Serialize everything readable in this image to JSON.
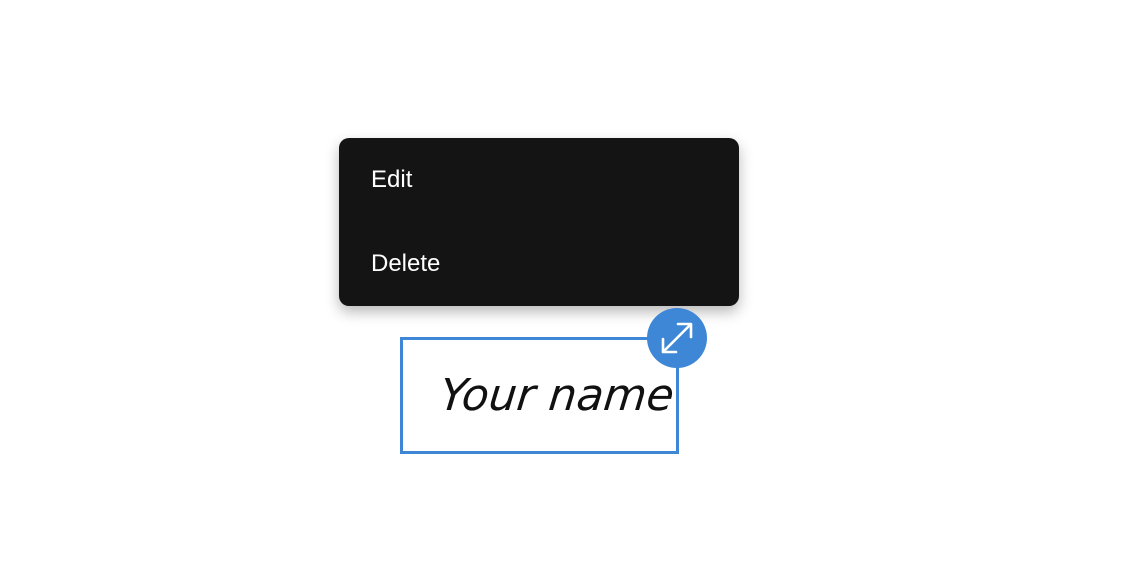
{
  "context_menu": {
    "items": [
      {
        "label": "Edit"
      },
      {
        "label": "Delete"
      }
    ]
  },
  "signature": {
    "text": "Your name"
  },
  "resize_handle": {
    "icon": "expand-arrows-icon"
  },
  "colors": {
    "menu_background": "#141414",
    "menu_text": "#ffffff",
    "accent": "#3e87d6",
    "page_background": "#ffffff"
  }
}
